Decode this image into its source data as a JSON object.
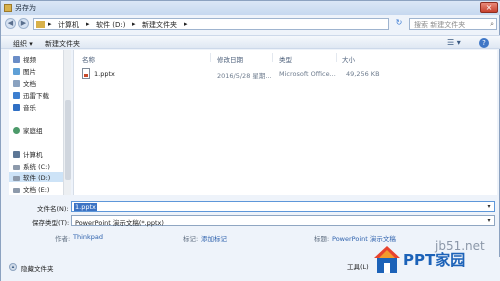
{
  "window": {
    "title": "另存为",
    "close_symbol": "×"
  },
  "address": {
    "back_symbol": "◀",
    "forward_symbol": "▶",
    "separator": "▸",
    "crumbs": [
      "计算机",
      "软件 (D:)",
      "新建文件夹"
    ],
    "refresh_symbol": "↻",
    "search_placeholder": "搜索 新建文件夹",
    "search_icon": "search-icon"
  },
  "toolbar": {
    "organize": "组织 ▾",
    "new_folder": "新建文件夹",
    "view_symbol": "☰ ▾",
    "help_symbol": "?"
  },
  "sidebar": {
    "items": [
      {
        "label": "视频",
        "icon": "video-icon",
        "color": "#6a8dc7"
      },
      {
        "label": "图片",
        "icon": "pictures-icon",
        "color": "#5fa0d6"
      },
      {
        "label": "文档",
        "icon": "documents-icon",
        "color": "#8aa2c0"
      },
      {
        "label": "迅雷下载",
        "icon": "thunder-download-icon",
        "color": "#3d7fd0"
      },
      {
        "label": "音乐",
        "icon": "music-icon",
        "color": "#2f6fc4"
      },
      {
        "label": "家庭组",
        "icon": "homegroup-icon",
        "color": "#4c9a6a"
      },
      {
        "label": "计算机",
        "icon": "computer-icon",
        "color": "#5d7796"
      },
      {
        "label": "系统 (C:)",
        "icon": "drive-icon",
        "color": "#8d9aab"
      },
      {
        "label": "软件 (D:)",
        "icon": "drive-icon",
        "color": "#8d9aab"
      },
      {
        "label": "文档 (E:)",
        "icon": "drive-icon",
        "color": "#8d9aab"
      }
    ]
  },
  "filelist": {
    "columns": [
      "名称",
      "修改日期",
      "类型",
      "大小"
    ],
    "files": [
      {
        "name": "1.pptx",
        "date": "2016/5/28 星期...",
        "type": "Microsoft Office...",
        "size": "49,256 KB"
      }
    ]
  },
  "form": {
    "filename_label": "文件名(N):",
    "filename_value": "1.pptx",
    "filetype_label": "保存类型(T):",
    "filetype_value": "PowerPoint 演示文稿(*.pptx)",
    "author_label": "作者:",
    "author_value": "Thinkpad",
    "tags_label": "标记:",
    "tags_value": "添加标记",
    "title_label": "标题:",
    "title_value": "PowerPoint 演示文稿"
  },
  "footer": {
    "hide_folders": "隐藏文件夹",
    "tools": "工具(L)"
  },
  "watermark": {
    "site": "jb51.net",
    "brand": "PPT家园"
  }
}
